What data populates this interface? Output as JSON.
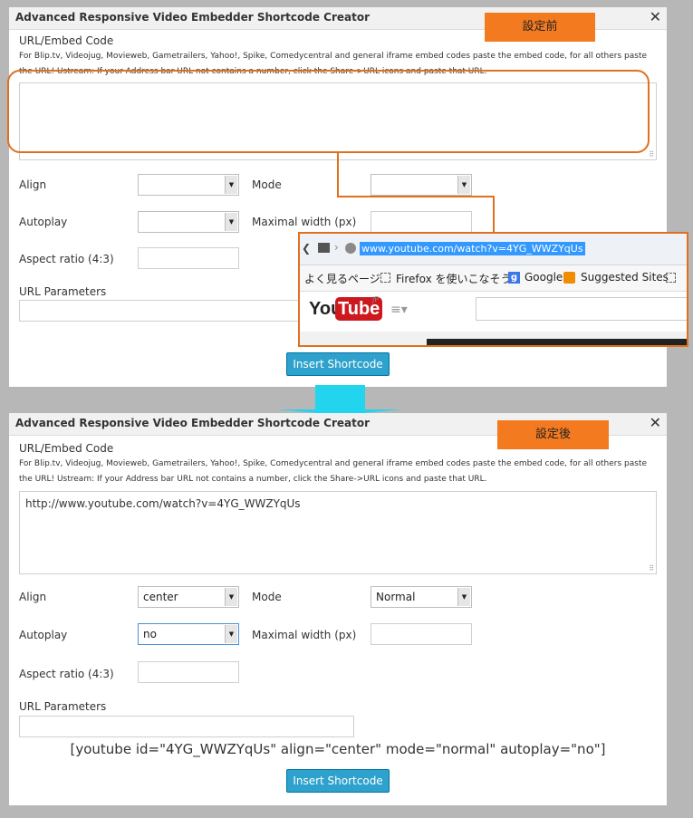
{
  "before": {
    "title": "Advanced Responsive Video Embedder Shortcode Creator",
    "badge": "設定前",
    "url_label": "URL/Embed Code",
    "help_text": "For Blip.tv, Videojug, Movieweb, Gametrailers, Yahoo!, Spike, Comedycentral and general iframe embed codes paste the embed code, for all others paste the URL! Ustream: If your Address bar URL not contains a number, click the Share->URL icons and paste that URL.",
    "url_value": "",
    "align_label": "Align",
    "align_value": "",
    "mode_label": "Mode",
    "mode_value": "",
    "autoplay_label": "Autoplay",
    "autoplay_value": "",
    "maxwidth_label": "Maximal width (px)",
    "aspect_label": "Aspect ratio (4:3)",
    "params_label": "URL Parameters",
    "insert_button": "Insert Shortcode"
  },
  "browser": {
    "url": "www.youtube.com/watch?v=4YG_WWZYqUs",
    "bookmark_1": "よく見るページ",
    "bookmark_2": "Firefox を使いこなそう",
    "bookmark_3": "Google",
    "bookmark_4": "Suggested Sites",
    "logo_you": "You",
    "logo_tube": "Tube",
    "logo_region": "JP"
  },
  "after": {
    "title": "Advanced Responsive Video Embedder Shortcode Creator",
    "badge": "設定後",
    "url_label": "URL/Embed Code",
    "help_text": "For Blip.tv, Videojug, Movieweb, Gametrailers, Yahoo!, Spike, Comedycentral and general iframe embed codes paste the embed code, for all others paste the URL! Ustream: If your Address bar URL not contains a number, click the Share->URL icons and paste that URL.",
    "url_value": "http://www.youtube.com/watch?v=4YG_WWZYqUs",
    "align_label": "Align",
    "align_value": "center",
    "mode_label": "Mode",
    "mode_value": "Normal",
    "autoplay_label": "Autoplay",
    "autoplay_value": "no",
    "maxwidth_label": "Maximal width (px)",
    "aspect_label": "Aspect ratio (4:3)",
    "params_label": "URL Parameters",
    "shortcode": "[youtube id=\"4YG_WWZYqUs\" align=\"center\" mode=\"normal\" autoplay=\"no\"]",
    "insert_button": "Insert Shortcode"
  },
  "colors": {
    "badge": "#f47a20",
    "annotation": "#e07020",
    "arrow": "#22d4ee",
    "button": "#2ea2cc"
  }
}
